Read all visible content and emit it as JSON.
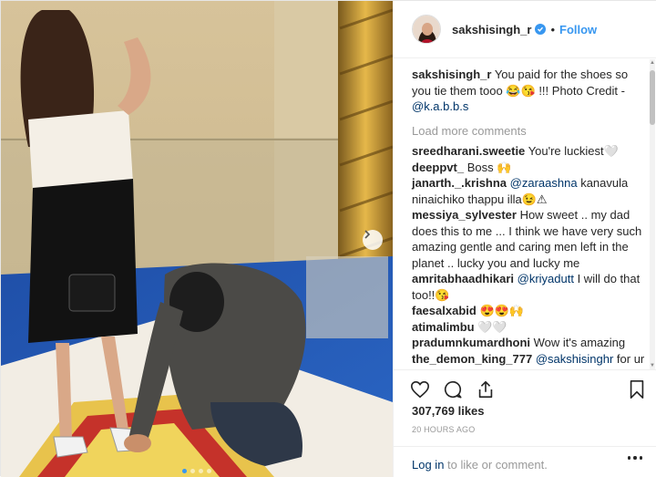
{
  "post": {
    "username": "sakshisingh_r",
    "separator": "•",
    "follow_label": "Follow",
    "caption": {
      "username": "sakshisingh_r",
      "text": "You paid for the shoes so you tie them tooo 😂😘 !!! Photo Credit - ",
      "mention": "@k.a.b.b.s"
    },
    "load_more_label": "Load more comments",
    "comments": [
      {
        "username": "sreedharani.sweetie",
        "text": "You're luckiest🤍",
        "mention": ""
      },
      {
        "username": "deeppvt_",
        "text": "Boss 🙌",
        "mention": ""
      },
      {
        "username": "janarth._.krishna",
        "mention": "@zaraashna",
        "text": "kanavula ninaichiko thappu illa😉⚠"
      },
      {
        "username": "messiya_sylvester",
        "text": "How sweet .. my dad does this to me ... I think we have very such amazing gentle and caring men left in the planet .. lucky you and lucky me",
        "mention": ""
      },
      {
        "username": "amritabhaadhikari",
        "mention": "@kriyadutt",
        "text": "I will do that too!!😘"
      },
      {
        "username": "faesalxabid",
        "text": "😍😍🙌",
        "mention": ""
      },
      {
        "username": "atimalimbu",
        "text": "🤍🤍",
        "mention": ""
      },
      {
        "username": "pradumnkumardhoni",
        "text": "Wow it's amazing",
        "mention": ""
      },
      {
        "username": "the_demon_king_777",
        "mention": "@sakshisinghr",
        "text": "for ur kind information that's not shoes that's slippers and even the world's sharpest nd cool man will also under wife😊😊😊"
      }
    ],
    "likes": "307,769 likes",
    "timestamp": "20 HOURS AGO",
    "login": {
      "link": "Log in",
      "text": " to like or comment."
    },
    "colors": {
      "accent": "#3897f0",
      "mention": "#003569",
      "muted": "#999999"
    },
    "carousel": {
      "slides": 4,
      "active": 0
    }
  }
}
